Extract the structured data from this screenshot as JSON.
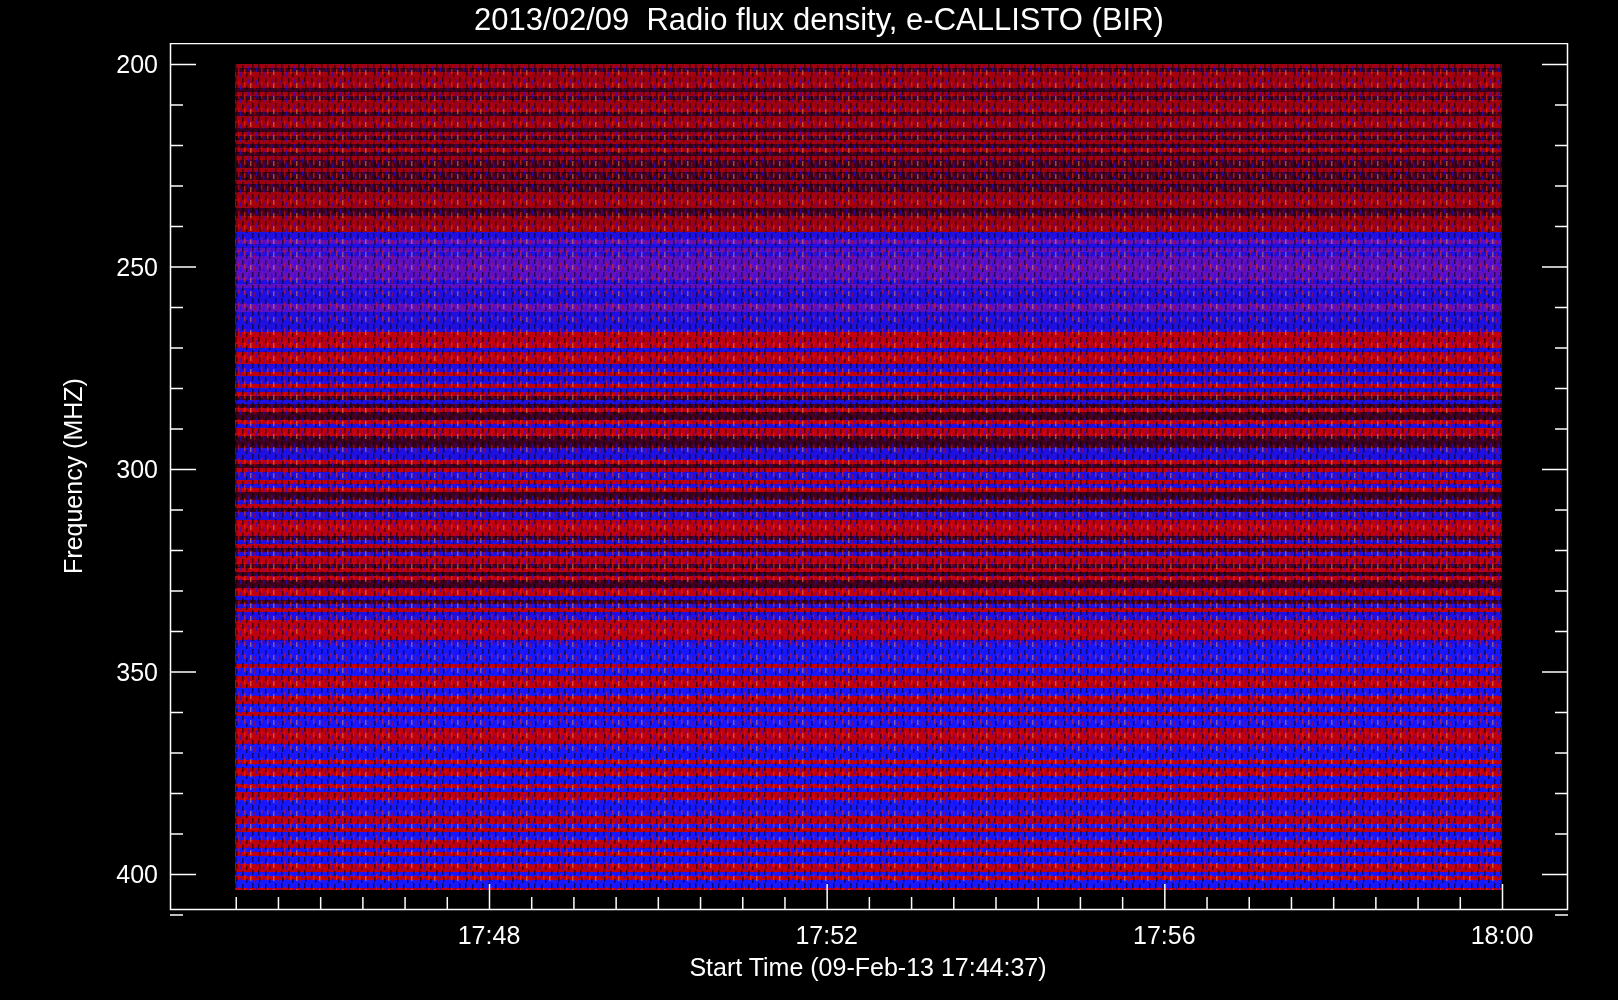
{
  "title": "2013/02/09  Radio flux density, e-CALLISTO (BIR)",
  "plot": {
    "ylabel": "Frequency (MHZ)",
    "xlabel": "Start Time (09-Feb-13 17:44:37)",
    "yticks": [
      "200",
      "250",
      "300",
      "350",
      "400"
    ],
    "xticks": [
      "17:48",
      "17:52",
      "17:56",
      "18:00"
    ]
  }
}
